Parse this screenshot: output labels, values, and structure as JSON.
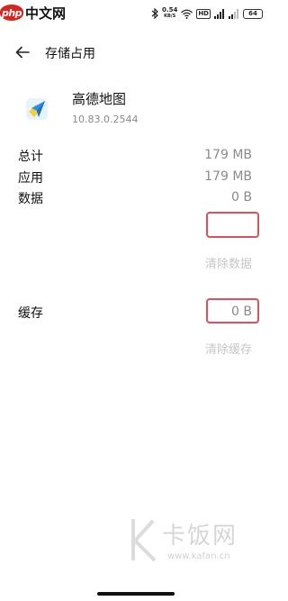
{
  "status_bar": {
    "brand_badge": "php",
    "brand_text": "中文网",
    "net_speed_value": "0.54",
    "net_speed_unit": "KB/S",
    "hd_tag": "HD",
    "battery": "64"
  },
  "header": {
    "title": "存储占用"
  },
  "app": {
    "name": "高德地图",
    "version": "10.83.0.2544"
  },
  "storage": {
    "total_label": "总计",
    "total_value": "179 MB",
    "app_label": "应用",
    "app_value": "179 MB",
    "data_label": "数据",
    "data_value": "0 B",
    "clear_data_label": "清除数据",
    "cache_label": "缓存",
    "cache_value": "0 B",
    "clear_cache_label": "清除缓存"
  },
  "watermark": {
    "text": "卡饭网",
    "url": "www.kafan.cn"
  },
  "colors": {
    "highlight": "#e0505a",
    "disabled_text": "#c6c6c6",
    "secondary_text": "#8a8a8a",
    "brand_red": "#d9251d"
  }
}
